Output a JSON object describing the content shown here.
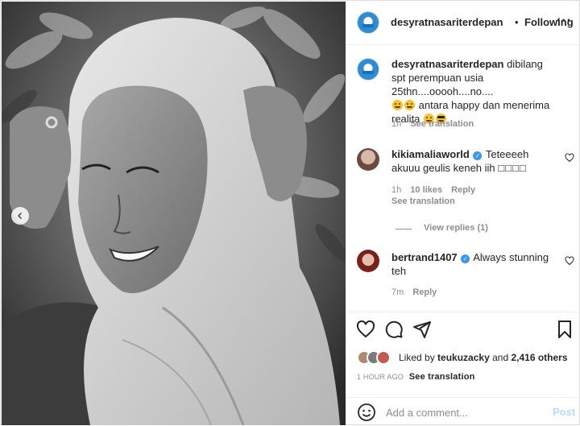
{
  "post": {
    "author": "desyratnasariterdepan",
    "dot": "•",
    "follow_label": "Following",
    "more_label": "···"
  },
  "caption": {
    "username": "desyratnasariterdepan",
    "text_part1": "dibilang spt perempuan usia 25thn....ooooh....no....",
    "text_part2": "antara happy dan menerima realita",
    "emojis": [
      "grinning-emoji",
      "rolling-laugh-emoji",
      "squint-tongue-emoji",
      "sunglasses-emoji"
    ],
    "time": "1h",
    "see_translation": "See translation"
  },
  "comments": [
    {
      "username": "kikiamaliaworld",
      "verified": true,
      "text": "Teteeeeh akuuu geulis keneh iih",
      "trailing_glyphs": "□□□□",
      "time": "1h",
      "likes": "10 likes",
      "reply": "Reply",
      "see_translation": "See translation",
      "view_replies": "View replies (1)"
    },
    {
      "username": "bertrand1407",
      "verified": true,
      "text": "Always stunning teh",
      "time": "7m",
      "reply": "Reply"
    }
  ],
  "likes": {
    "prefix": "Liked by",
    "first_liker": "teukuzacky",
    "and": "and",
    "others": "2,416 others"
  },
  "timestamp": "1 HOUR AGO",
  "see_translation": "See translation",
  "comment_box": {
    "placeholder": "Add a comment...",
    "post_label": "Post"
  },
  "icons": [
    "heart-icon",
    "comment-icon",
    "share-icon",
    "bookmark-icon",
    "emoji-icon",
    "chevron-left-icon",
    "more-icon"
  ],
  "colors": {
    "link_blue_disabled": "#b2dffc",
    "verified_blue": "#3897f0",
    "muted_text": "#8e8e8e",
    "text": "#262626"
  }
}
